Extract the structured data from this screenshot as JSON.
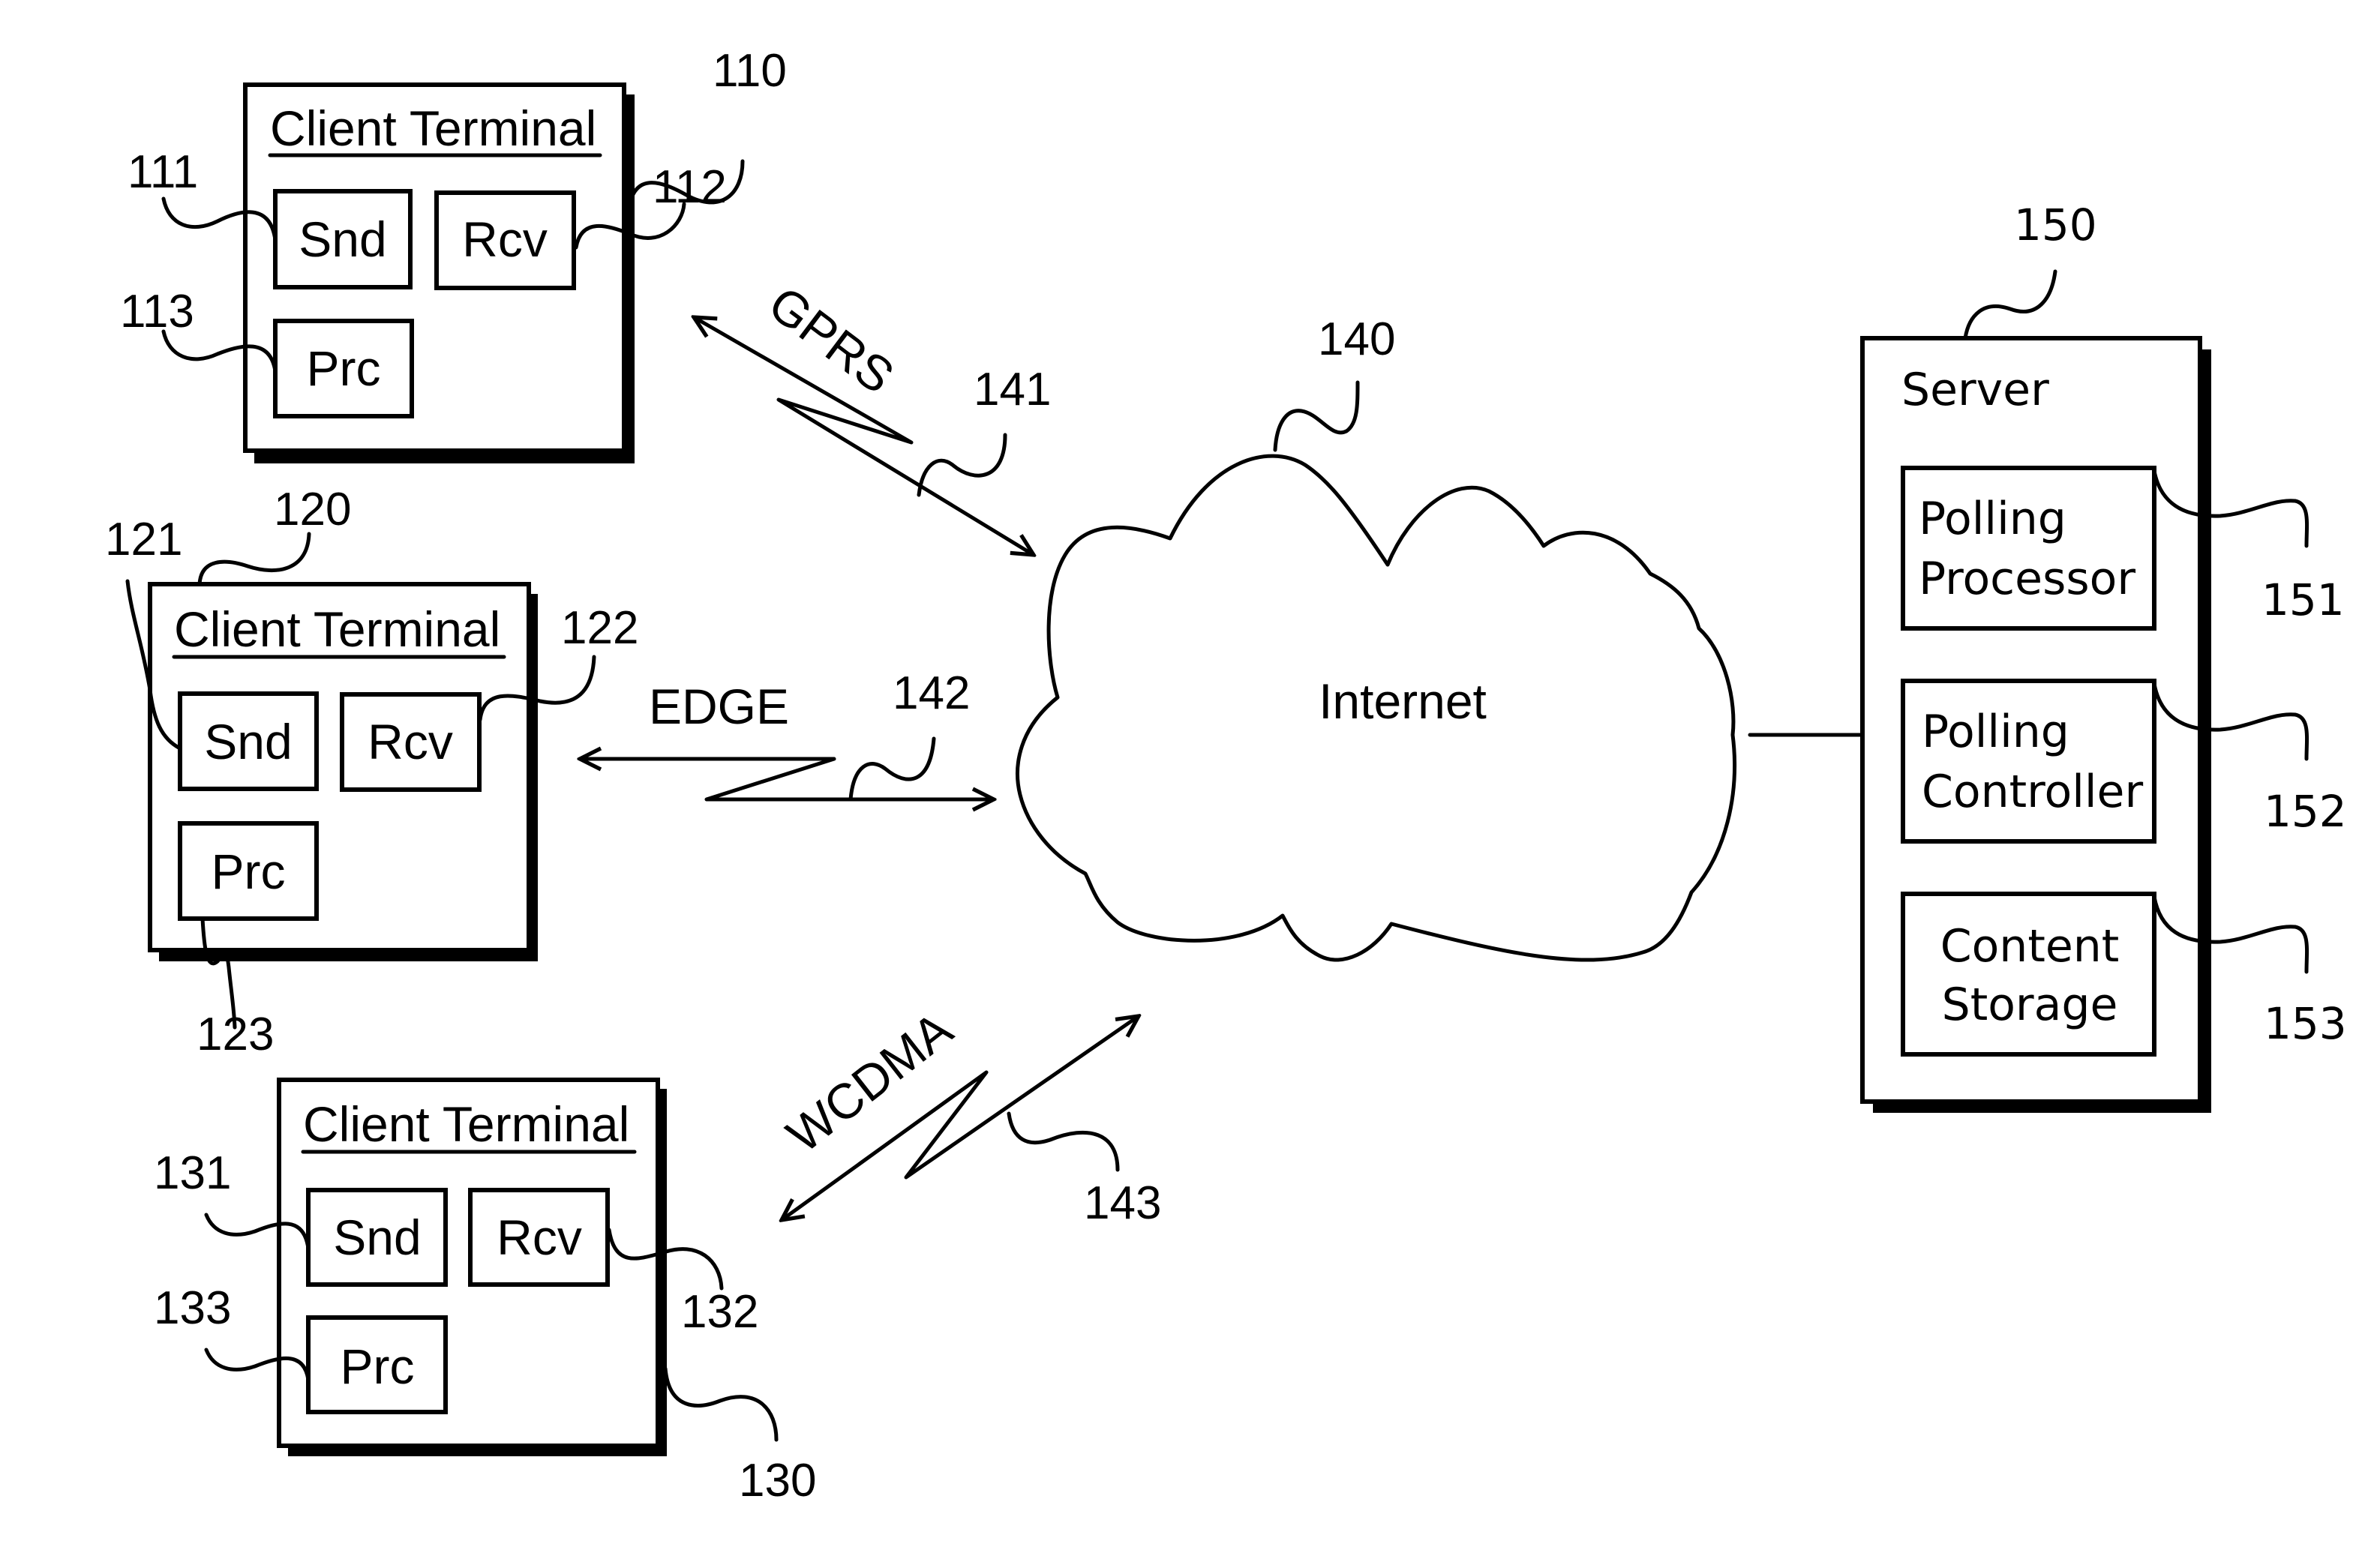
{
  "diagram": {
    "clients": [
      {
        "ref": "110",
        "title": "Client Terminal",
        "snd": "Snd",
        "rcv": "Rcv",
        "prc": "Prc",
        "snd_ref": "111",
        "rcv_ref": "112",
        "prc_ref": "113"
      },
      {
        "ref": "120",
        "title": "Client Terminal",
        "snd": "Snd",
        "rcv": "Rcv",
        "prc": "Prc",
        "snd_ref": "121",
        "rcv_ref": "122",
        "prc_ref": "123"
      },
      {
        "ref": "130",
        "title": "Client Terminal",
        "snd": "Snd",
        "rcv": "Rcv",
        "prc": "Prc",
        "snd_ref": "131",
        "rcv_ref": "132",
        "prc_ref": "133"
      }
    ],
    "links": [
      {
        "ref": "141",
        "label": "GPRS"
      },
      {
        "ref": "142",
        "label": "EDGE"
      },
      {
        "ref": "143",
        "label": "WCDMA"
      }
    ],
    "network": {
      "ref": "140",
      "label": "Internet"
    },
    "server": {
      "ref": "150",
      "title": "Server",
      "modules": [
        {
          "ref": "151",
          "line1": "Polling",
          "line2": "Processor"
        },
        {
          "ref": "152",
          "line1": "Polling",
          "line2": "Controller"
        },
        {
          "ref": "153",
          "line1": "Content",
          "line2": "Storage"
        }
      ]
    }
  }
}
